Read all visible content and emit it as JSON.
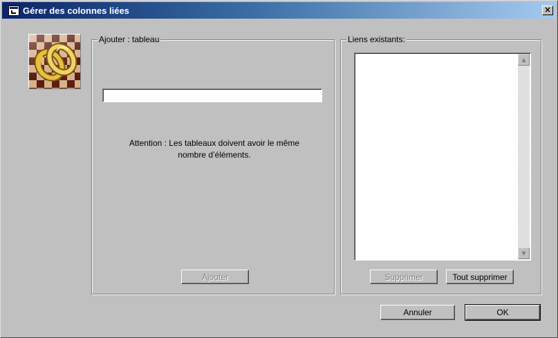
{
  "window": {
    "title": "Gérer des colonnes liées",
    "close_glyph": "×"
  },
  "add_group": {
    "label": "Ajouter : tableau",
    "input_value": "",
    "warning_line1": "Attention : Les tableaux doivent avoir le même",
    "warning_line2": "nombre d’éléments.",
    "add_button": "Ajouter"
  },
  "links_group": {
    "label": "Liens existants:",
    "items": [],
    "delete_button": "Supprimer",
    "delete_all_button": "Tout supprimer"
  },
  "footer": {
    "cancel_button": "Annuler",
    "ok_button": "OK"
  },
  "icons": {
    "title": "app-icon",
    "logo": "linked-chain-rings-icon",
    "scroll_up": "▲",
    "scroll_down": "▼"
  }
}
